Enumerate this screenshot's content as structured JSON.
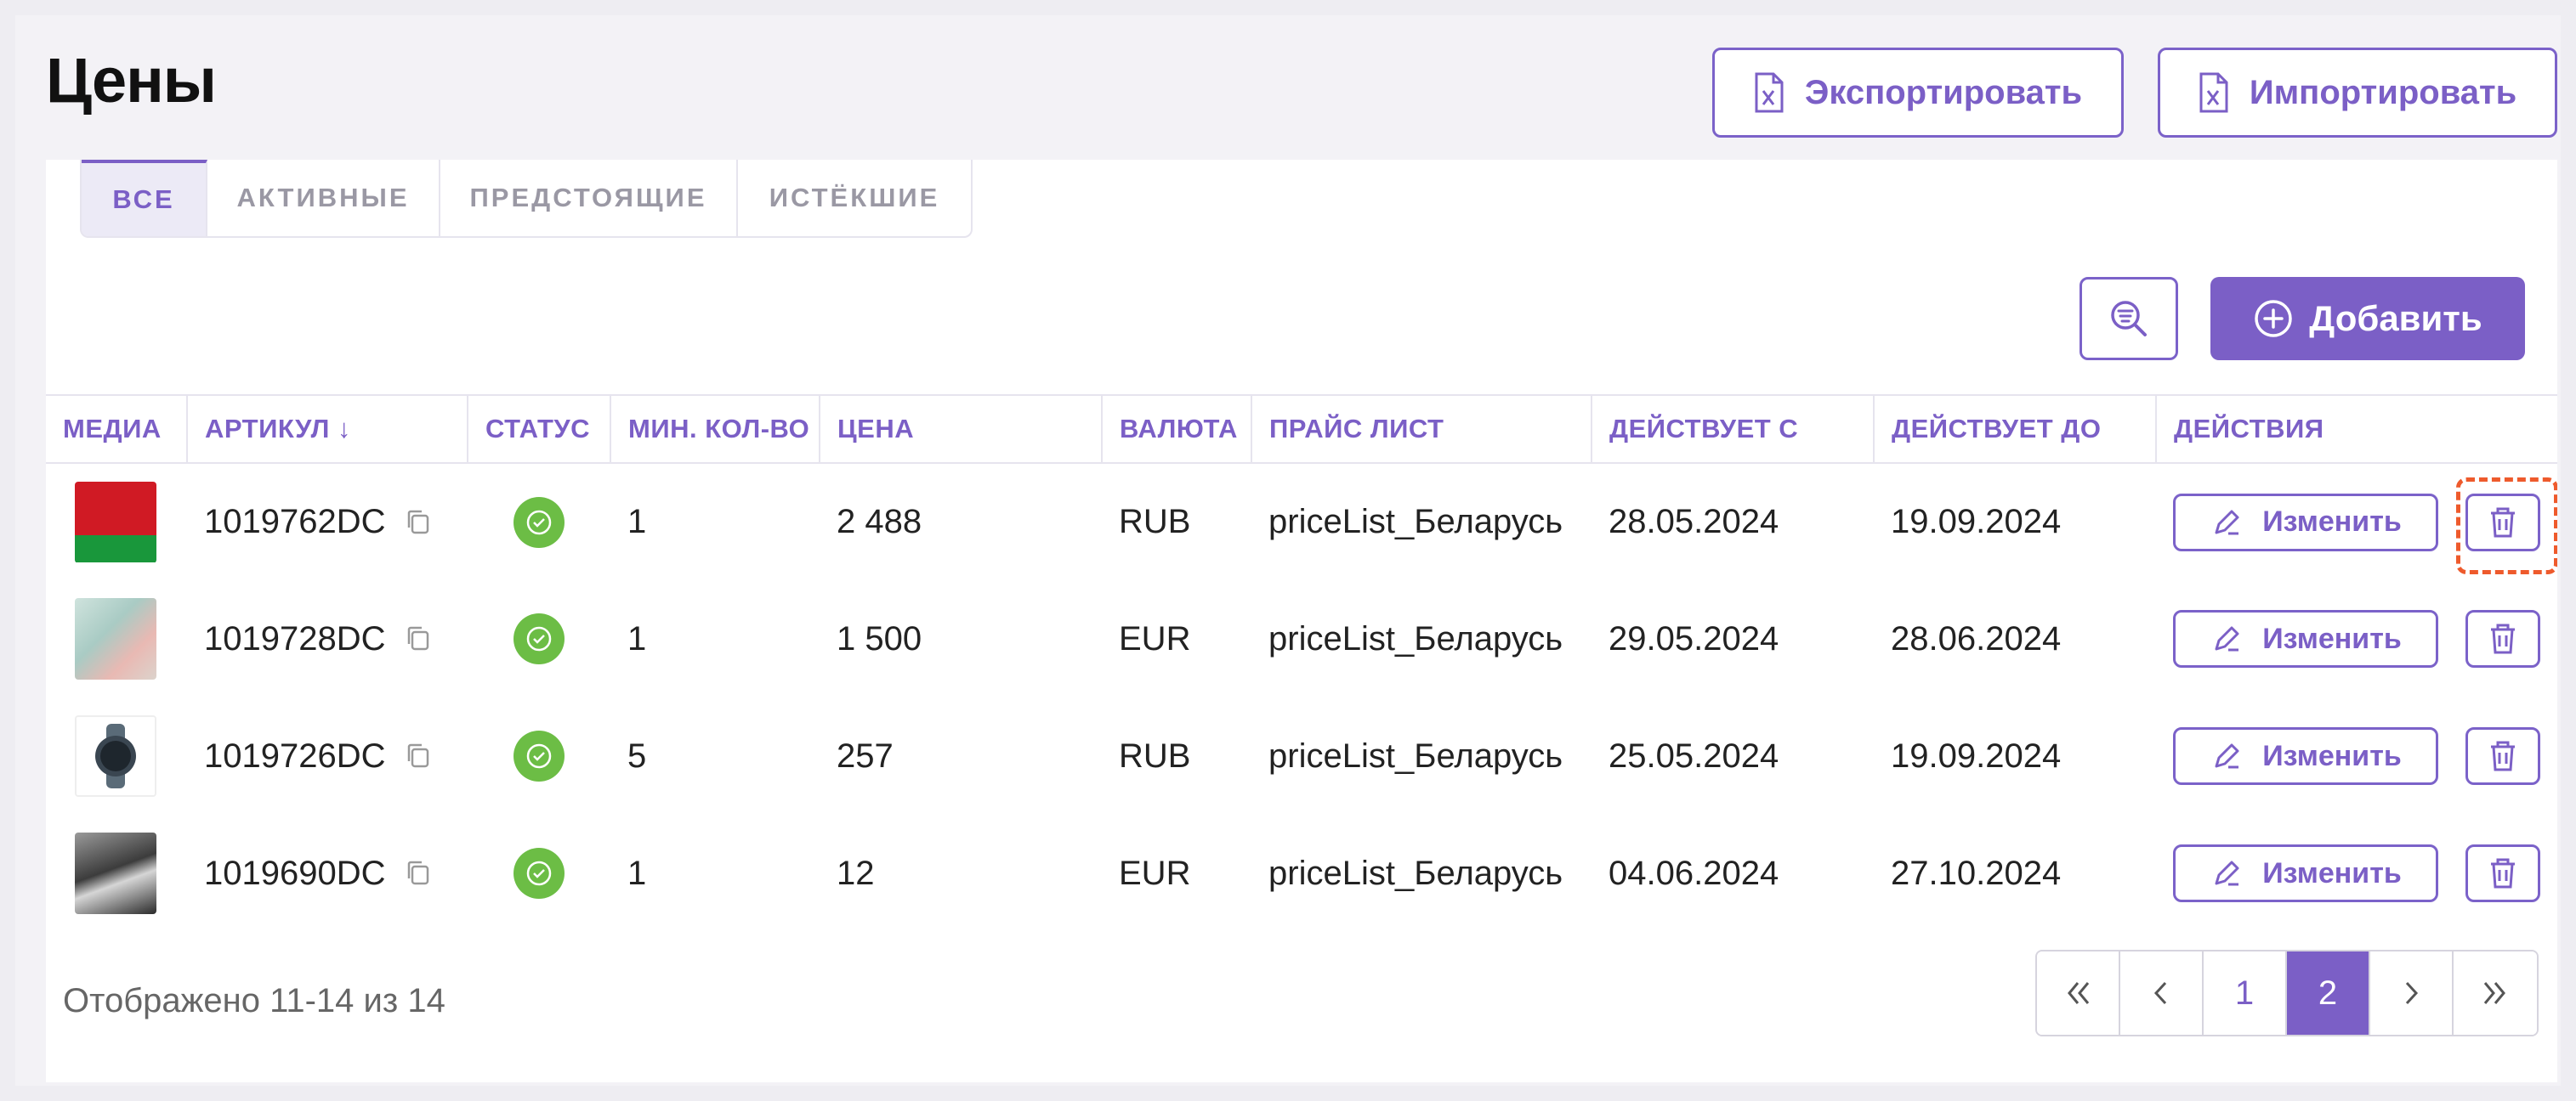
{
  "header": {
    "title": "Цены",
    "export_label": "Экспортировать",
    "import_label": "Импортировать"
  },
  "tabs": [
    {
      "label": "ВСЕ",
      "active": true
    },
    {
      "label": "АКТИВНЫЕ",
      "active": false
    },
    {
      "label": "ПРЕДСТОЯЩИЕ",
      "active": false
    },
    {
      "label": "ИСТЁКШИЕ",
      "active": false
    }
  ],
  "toolbar": {
    "add_label": "Добавить"
  },
  "table": {
    "columns": [
      "МЕДИА",
      "АРТИКУЛ ↓",
      "СТАТУС",
      "МИН. КОЛ-ВО",
      "ЦЕНА",
      "ВАЛЮТА",
      "ПРАЙС ЛИСТ",
      "ДЕЙСТВУЕТ С",
      "ДЕЙСТВУЕТ ДО",
      "ДЕЙСТВИЯ"
    ],
    "rows": [
      {
        "sku": "1019762DC",
        "status": "active",
        "min_qty": "1",
        "price": "2 488",
        "currency": "RUB",
        "price_list": "priceList_Беларусь",
        "valid_from": "28.05.2024",
        "valid_to": "19.09.2024",
        "edit": "Изменить",
        "media": "flag"
      },
      {
        "sku": "1019728DC",
        "status": "active",
        "min_qty": "1",
        "price": "1 500",
        "currency": "EUR",
        "price_list": "priceList_Беларусь",
        "valid_from": "29.05.2024",
        "valid_to": "28.06.2024",
        "edit": "Изменить",
        "media": "product-bottles"
      },
      {
        "sku": "1019726DC",
        "status": "active",
        "min_qty": "5",
        "price": "257",
        "currency": "RUB",
        "price_list": "priceList_Беларусь",
        "valid_from": "25.05.2024",
        "valid_to": "19.09.2024",
        "edit": "Изменить",
        "media": "smartwatch"
      },
      {
        "sku": "1019690DC",
        "status": "active",
        "min_qty": "1",
        "price": "12",
        "currency": "EUR",
        "price_list": "priceList_Беларусь",
        "valid_from": "04.06.2024",
        "valid_to": "27.10.2024",
        "edit": "Изменить",
        "media": "motorcycle-photo"
      }
    ]
  },
  "footer": {
    "summary": "Отображено 11-14 из 14"
  },
  "pagination": {
    "first": "«",
    "prev": "‹",
    "pages": [
      "1",
      "2"
    ],
    "current": "2",
    "next": "›",
    "last": "»"
  },
  "colors": {
    "accent": "#7b5fc6",
    "status_ok": "#6cbd45",
    "highlight": "#ee5a2c"
  }
}
